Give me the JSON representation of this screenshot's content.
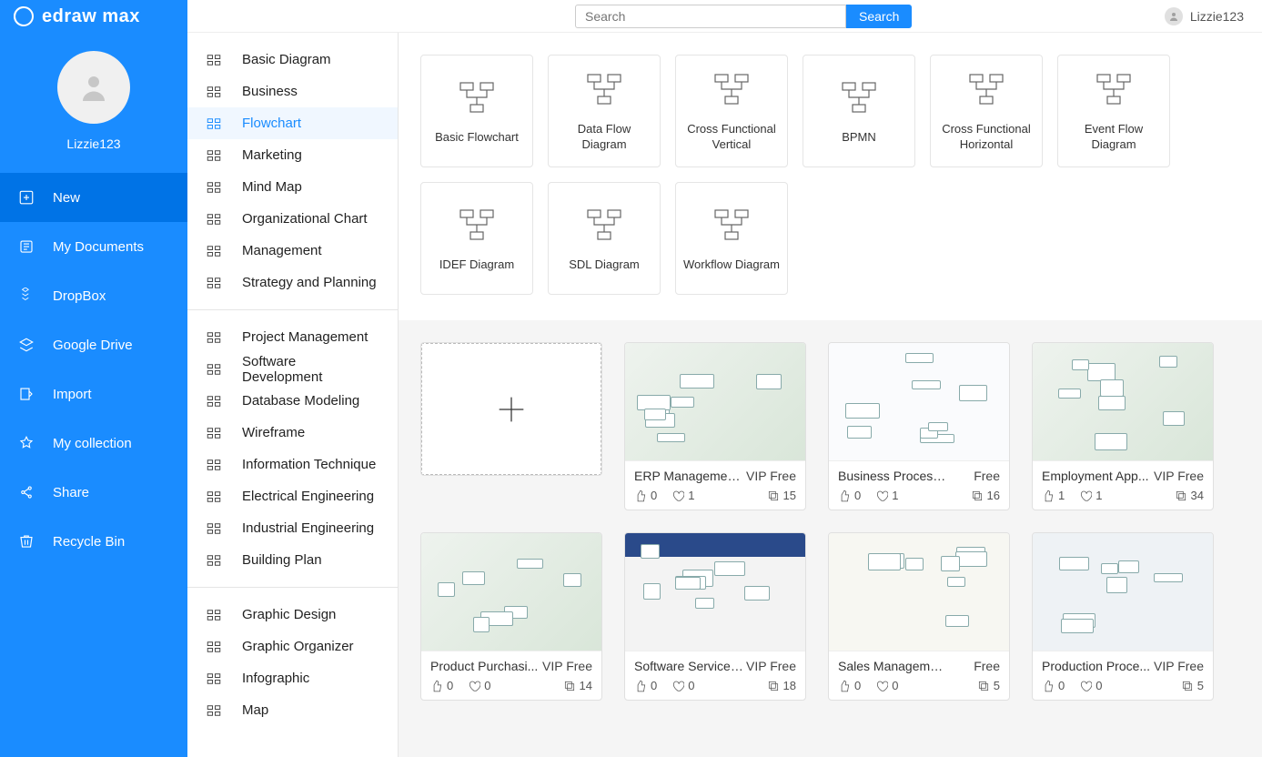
{
  "brand": "edraw max",
  "user": {
    "name": "Lizzie123"
  },
  "search": {
    "placeholder": "Search",
    "button": "Search"
  },
  "nav": [
    {
      "label": "New",
      "active": true
    },
    {
      "label": "My Documents"
    },
    {
      "label": "DropBox"
    },
    {
      "label": "Google Drive"
    },
    {
      "label": "Import"
    },
    {
      "label": "My collection"
    },
    {
      "label": "Share"
    },
    {
      "label": "Recycle Bin"
    }
  ],
  "categories": {
    "group1": [
      {
        "label": "Basic Diagram"
      },
      {
        "label": "Business"
      },
      {
        "label": "Flowchart",
        "active": true
      },
      {
        "label": "Marketing"
      },
      {
        "label": "Mind Map"
      },
      {
        "label": "Organizational Chart"
      },
      {
        "label": "Management"
      },
      {
        "label": "Strategy and Planning"
      }
    ],
    "group2": [
      {
        "label": "Project Management"
      },
      {
        "label": "Software Development"
      },
      {
        "label": "Database Modeling"
      },
      {
        "label": "Wireframe"
      },
      {
        "label": "Information Technique"
      },
      {
        "label": "Electrical Engineering"
      },
      {
        "label": "Industrial Engineering"
      },
      {
        "label": "Building Plan"
      }
    ],
    "group3": [
      {
        "label": "Graphic Design"
      },
      {
        "label": "Graphic Organizer"
      },
      {
        "label": "Infographic"
      },
      {
        "label": "Map"
      }
    ]
  },
  "types": [
    {
      "label": "Basic Flowchart"
    },
    {
      "label": "Data Flow Diagram"
    },
    {
      "label": "Cross Functional Vertical"
    },
    {
      "label": "BPMN"
    },
    {
      "label": "Cross Functional Horizontal"
    },
    {
      "label": "Event Flow Diagram"
    },
    {
      "label": "IDEF Diagram"
    },
    {
      "label": "SDL Diagram"
    },
    {
      "label": "Workflow Diagram"
    }
  ],
  "templates": [
    {
      "title": "ERP Managemen...",
      "price": "VIP Free",
      "likes": 0,
      "favs": 1,
      "copies": 15,
      "thumb": "alt0"
    },
    {
      "title": "Business Process Mo...",
      "price": "Free",
      "likes": 0,
      "favs": 1,
      "copies": 16,
      "thumb": "alt1"
    },
    {
      "title": "Employment App...",
      "price": "VIP Free",
      "likes": 1,
      "favs": 1,
      "copies": 34,
      "thumb": "alt0"
    },
    {
      "title": "Product Purchasi...",
      "price": "VIP Free",
      "likes": 0,
      "favs": 0,
      "copies": 14,
      "thumb": "alt0"
    },
    {
      "title": "Software Service ...",
      "price": "VIP Free",
      "likes": 0,
      "favs": 0,
      "copies": 18,
      "thumb": "alt2"
    },
    {
      "title": "Sales Management C...",
      "price": "Free",
      "likes": 0,
      "favs": 0,
      "copies": 5,
      "thumb": "alt3"
    },
    {
      "title": "Production Proce...",
      "price": "VIP Free",
      "likes": 0,
      "favs": 0,
      "copies": 5,
      "thumb": "alt4"
    }
  ]
}
